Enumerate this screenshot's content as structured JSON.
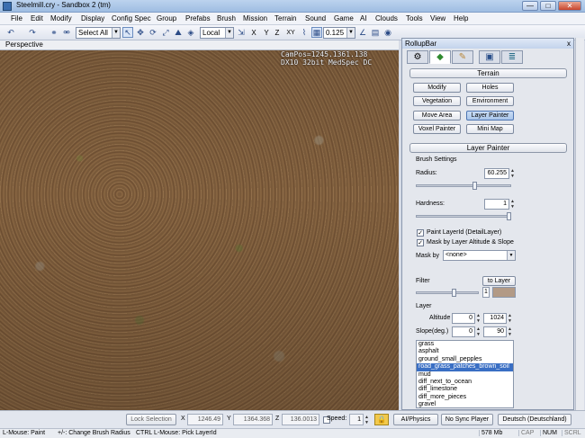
{
  "window": {
    "title": "Steelmill.cry - Sandbox 2 (tm)",
    "min": "—",
    "max": "□",
    "close": "✕"
  },
  "menu": [
    "File",
    "Edit",
    "Modify",
    "Display",
    "Config Spec",
    "Group",
    "Prefabs",
    "Brush",
    "Mission",
    "Terrain",
    "Sound",
    "Game",
    "AI",
    "Clouds",
    "Tools",
    "View",
    "Help"
  ],
  "toolbar": {
    "selection_combo": "Select All",
    "coord_combo": "Local",
    "axes": [
      "X",
      "Y",
      "Z",
      "XY"
    ],
    "snap_value": "0.125",
    "icons": [
      "undo-icon",
      "redo-icon",
      "link-icon",
      "unlink-icon",
      "select-icon",
      "move-icon",
      "rotate-icon",
      "scale-icon",
      "terrain-icon"
    ]
  },
  "viewport": {
    "label": "Perspective",
    "campos_line1": "CamPos=1245.1361.138",
    "campos_line2": "DX10 32bit MedSpec DC"
  },
  "rollup": {
    "title": "RollupBar",
    "close": "x",
    "tabs": [
      "objects-tab-icon",
      "terrain-tab-icon",
      "modeling-tab-icon",
      "display-tab-icon",
      "layers-tab-icon"
    ],
    "terrain_header": "Terrain",
    "terrain_buttons": [
      "Modify",
      "Holes",
      "Vegetation",
      "Environment",
      "Move Area",
      "Layer Painter",
      "Voxel Painter",
      "Mini Map"
    ],
    "active_button": "Layer Painter",
    "layer_painter_header": "Layer Painter",
    "brush_settings_label": "Brush Settings",
    "radius_label": "Radius:",
    "radius_value": "60.255",
    "radius_fraction": 0.62,
    "hardness_label": "Hardness:",
    "hardness_value": "1",
    "hardness_fraction": 1.0,
    "paint_layerid_label": "Paint LayerId (DetailLayer)",
    "paint_layerid_checked": true,
    "mask_altitude_label": "Mask by Layer Altitude & Slope",
    "mask_altitude_checked": true,
    "mask_by_label": "Mask by",
    "mask_by_value": "<none>",
    "filter_label": "Filter",
    "to_layer_button": "to Layer",
    "filter_value": "1",
    "filter_color": "#b29a86",
    "layer_label": "Layer",
    "altitude_label": "Altitude",
    "altitude_min": "0",
    "altitude_max": "1024",
    "slope_label": "Slope(deg.)",
    "slope_min": "0",
    "slope_max": "90",
    "layers": [
      "grass",
      "asphalt",
      "ground_small_pepples",
      "road_grass_patches_brown_soil",
      "mud",
      "diff_next_to_ocean",
      "diff_limestone",
      "diff_more_pieces",
      "gravel"
    ],
    "selected_layer": "road_grass_patches_brown_soil"
  },
  "bottombar": {
    "lock_selection": "Lock Selection",
    "x_label": "X",
    "x_value": "1246.49",
    "y_label": "Y",
    "y_value": "1364.368",
    "z_label": "Z",
    "z_value": "136.0013",
    "speed_label": "Speed:",
    "speed_value": "1",
    "ai_physics": "AI/Physics",
    "no_sync_player": "No Sync Player",
    "language": "Deutsch (Deutschland)"
  },
  "statusbar": {
    "hint1": "L-Mouse: Paint",
    "hint2": "+/-: Change Brush Radius",
    "hint3": "CTRL L-Mouse: Pick LayerId",
    "memory": "578 Mb",
    "cap": "CAP",
    "num": "NUM",
    "scrl": "SCRL"
  }
}
